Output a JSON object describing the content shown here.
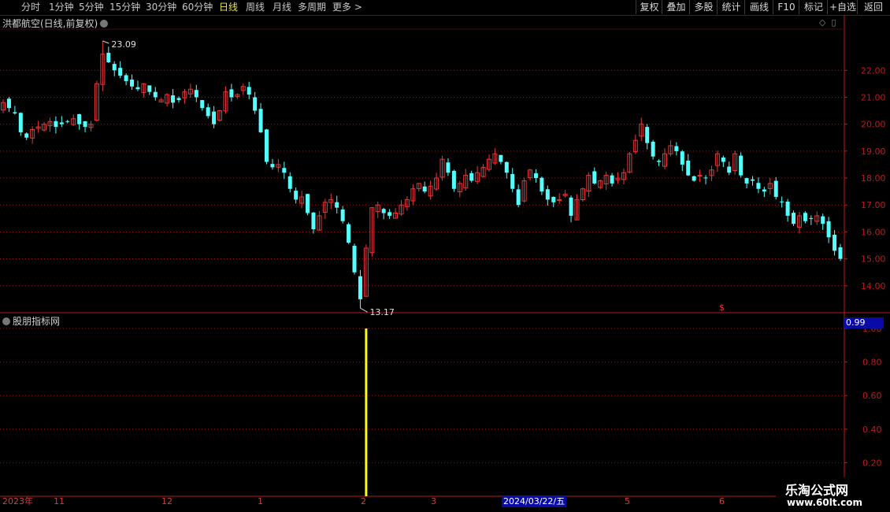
{
  "toolbar": {
    "periods": [
      {
        "label": "分时",
        "active": false
      },
      {
        "label": "1分钟",
        "active": false
      },
      {
        "label": "5分钟",
        "active": false
      },
      {
        "label": "15分钟",
        "active": false
      },
      {
        "label": "30分钟",
        "active": false
      },
      {
        "label": "60分钟",
        "active": false
      },
      {
        "label": "日线",
        "active": true
      },
      {
        "label": "周线",
        "active": false
      },
      {
        "label": "月线",
        "active": false
      },
      {
        "label": "多周期",
        "active": false
      },
      {
        "label": "更多",
        "active": false
      }
    ],
    "more_arrow": ">",
    "right_buttons": [
      "复权",
      "叠加",
      "多股",
      "统计",
      "画线",
      "F10",
      "标记",
      "+自选",
      "返回"
    ]
  },
  "main_chart": {
    "title": "洪都航空(日线,前复权)",
    "high_label": "23.09",
    "low_label": "13.17",
    "y_ticks": [
      "22.00",
      "21.00",
      "20.00",
      "19.00",
      "18.00",
      "17.00",
      "16.00",
      "15.00",
      "14.00"
    ],
    "marker": "$"
  },
  "indicator": {
    "title": "股朋指标网",
    "current_value": "0.99",
    "y_ticks": [
      "1.00",
      "0.80",
      "0.60",
      "0.40",
      "0.20"
    ]
  },
  "x_axis": {
    "labels": [
      "2023年",
      "11",
      "12",
      "1",
      "2",
      "3",
      "5",
      "6"
    ],
    "selected_date": "2024/03/22/五"
  },
  "watermark": {
    "line1": "乐淘公式网",
    "line2": "www.60lt.com"
  },
  "colors": {
    "up": "#e8383a",
    "down": "#54ffff",
    "axis": "#b41e1e",
    "signal": "#ffff00",
    "active_tab": "#e9e44a"
  },
  "chart_data": {
    "type": "candlestick",
    "symbol": "洪都航空",
    "period": "日线",
    "y_range": [
      13.0,
      23.5
    ],
    "high": 23.09,
    "low": 13.17,
    "closes": [
      20.8,
      20.6,
      20.4,
      19.7,
      19.5,
      19.8,
      19.9,
      20.0,
      20.1,
      19.9,
      20.0,
      20.1,
      20.2,
      20.0,
      19.9,
      20.0,
      21.5,
      22.6,
      22.3,
      22.0,
      21.8,
      21.6,
      21.4,
      21.3,
      21.5,
      21.2,
      21.0,
      20.9,
      21.1,
      20.8,
      20.9,
      21.2,
      21.3,
      21.0,
      20.6,
      20.3,
      20.0,
      20.5,
      21.2,
      21.0,
      21.1,
      21.4,
      21.1,
      20.5,
      19.7,
      18.6,
      18.4,
      18.5,
      18.2,
      17.6,
      17.2,
      17.3,
      16.7,
      16.1,
      16.6,
      17.1,
      17.2,
      16.9,
      16.4,
      15.6,
      14.5,
      13.5,
      15.4,
      16.9,
      17.0,
      16.7,
      16.6,
      16.7,
      17.0,
      17.2,
      17.6,
      17.8,
      17.5,
      17.7,
      18.0,
      18.7,
      18.2,
      17.6,
      17.8,
      18.1,
      17.9,
      18.2,
      18.4,
      18.7,
      18.9,
      18.6,
      18.2,
      17.6,
      17.0,
      17.9,
      18.3,
      18.0,
      17.5,
      17.2,
      17.1,
      17.2,
      17.4,
      16.6,
      17.2,
      17.6,
      18.1,
      17.8,
      17.9,
      18.1,
      17.8,
      18.0,
      18.2,
      18.9,
      19.4,
      20.0,
      19.3,
      18.8,
      18.6,
      18.9,
      19.2,
      19.0,
      18.5,
      18.1,
      17.9,
      18.1,
      18.0,
      18.3,
      18.9,
      18.6,
      18.2,
      18.9,
      18.1,
      17.8,
      17.9,
      17.6,
      17.5,
      17.8,
      17.3,
      17.1,
      16.6,
      16.3,
      16.6,
      16.4,
      16.5,
      16.6,
      16.3,
      15.8,
      15.3,
      15.0
    ],
    "indicator_signal": {
      "index": 62,
      "value": 1.0
    },
    "indicator_last_value": 0.99
  }
}
